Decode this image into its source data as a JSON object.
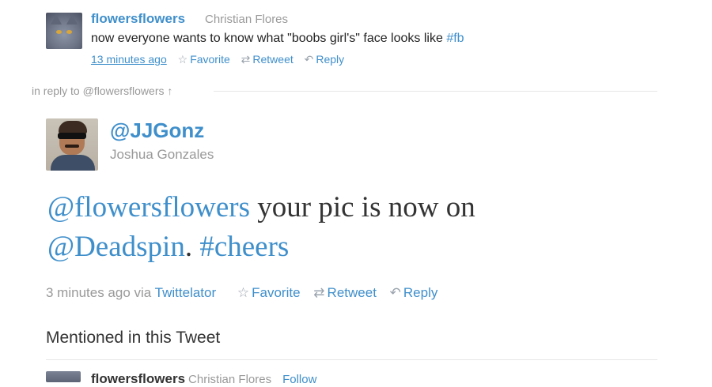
{
  "reply_tweet": {
    "username": "flowersflowers",
    "fullname": "Christian Flores",
    "text": "now everyone wants to know what \"boobs girl's\" face looks like ",
    "hashtag": "#fb",
    "time": "13 minutes ago",
    "favorite": "Favorite",
    "retweet": "Retweet",
    "reply": "Reply"
  },
  "in_reply_to": "in reply to @flowersflowers ↑",
  "main_tweet": {
    "handle": "@JJGonz",
    "fullname": "Joshua Gonzales",
    "mention1": "@flowersflowers",
    "text1": " your pic is now on",
    "mention2": "@Deadspin",
    "text2": ". ",
    "hashtag": "#cheers",
    "time": "3 minutes ago via ",
    "via": "Twittelator",
    "favorite": "Favorite",
    "retweet": "Retweet",
    "reply": "Reply"
  },
  "mentioned_heading": "Mentioned in this Tweet",
  "mentioned_user": {
    "username": "flowersflowers",
    "fullname": "Christian Flores",
    "follow": "Follow"
  },
  "icons": {
    "favorite": "star-icon",
    "retweet": "retweet-icon",
    "reply": "reply-icon"
  },
  "colors": {
    "link": "#3f8fcb",
    "muted": "#999999",
    "text": "#333333"
  }
}
